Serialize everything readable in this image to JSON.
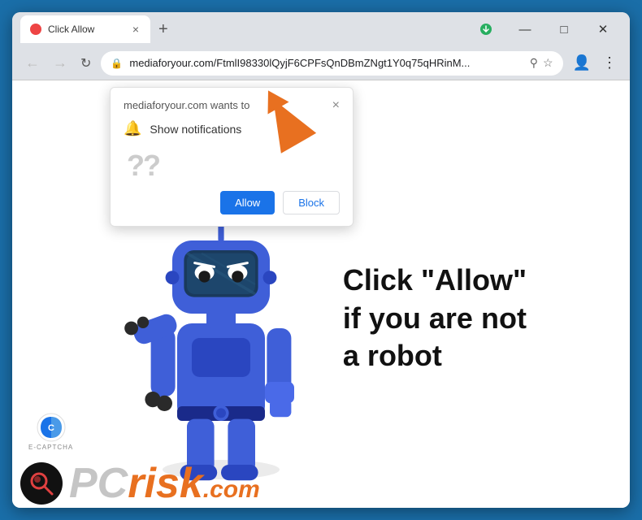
{
  "browser": {
    "tab_title": "Click Allow",
    "tab_close_label": "×",
    "new_tab_label": "+",
    "address": "mediaforyour.com/FtmlI98330lQyjF6CPFsQnDBmZNgt1Y0q75qHRinM...",
    "address_full": "mediaforyour.com/FtmlI98330lQyjF6CPFsQnDBmZNgt1Y0q75qHRinM...",
    "nav_back": "←",
    "nav_forward": "→",
    "nav_refresh": "↻",
    "minimize": "—",
    "maximize": "□",
    "close": "✕"
  },
  "popup": {
    "title": "mediaforyour.com wants to",
    "close_label": "×",
    "notification_label": "Show notifications",
    "question_marks": "??",
    "allow_button": "Allow",
    "block_button": "Block"
  },
  "page": {
    "main_text_line1": "Click \"Allow\"",
    "main_text_line2": "if you are not",
    "main_text_line3": "a robot",
    "ecaptcha_label": "E-CAPTCHA",
    "pcrisk_pc": "PC",
    "pcrisk_risk": "risk",
    "pcrisk_dotcom": ".com"
  },
  "icons": {
    "lock": "🔒",
    "bell": "🔔",
    "search": "⚲",
    "star": "☆",
    "profile": "👤",
    "menu": "⋮",
    "download": "⬇"
  }
}
